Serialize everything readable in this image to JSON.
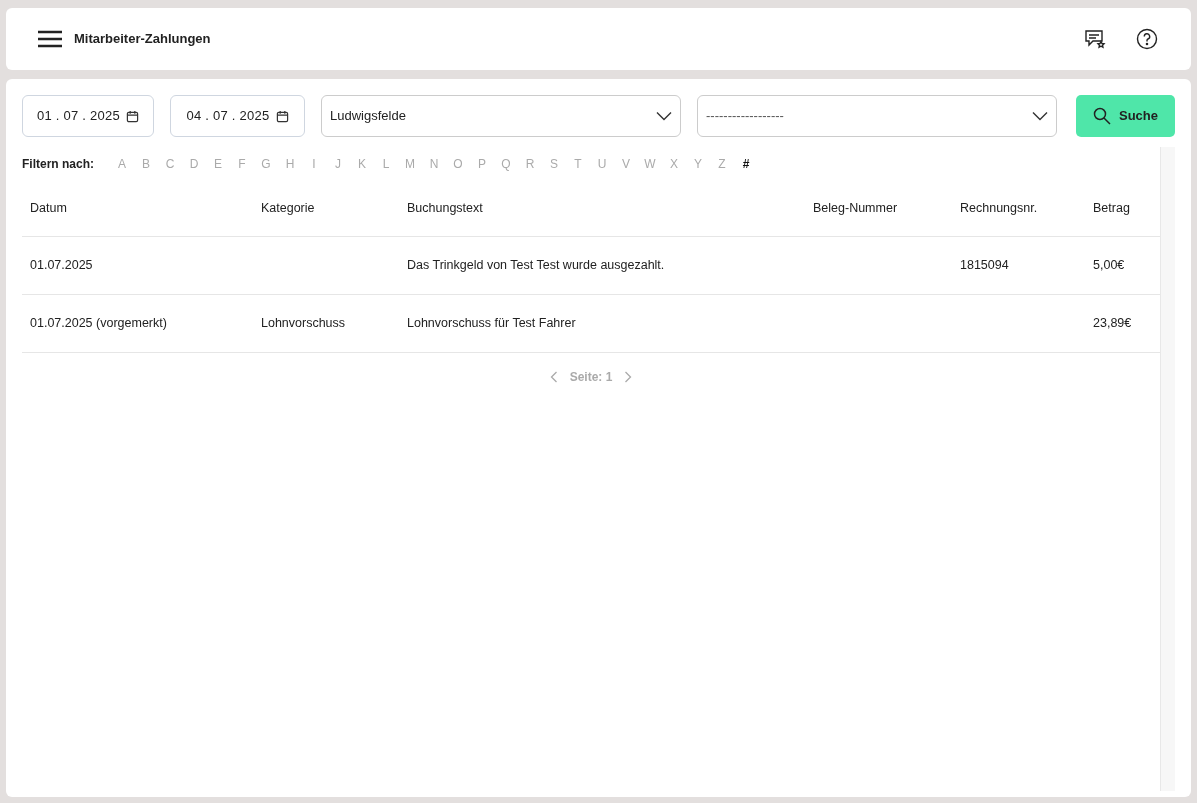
{
  "header": {
    "title": "Mitarbeiter-Zahlungen"
  },
  "filters": {
    "date_from": "01 . 07 . 2025",
    "date_to": "04 . 07 . 2025",
    "location": "Ludwigsfelde",
    "select_2": "------------------",
    "search_button": "Suche"
  },
  "letter_filter": {
    "label": "Filtern nach:",
    "letters": [
      {
        "label": "A",
        "selected": false
      },
      {
        "label": "B",
        "selected": false
      },
      {
        "label": "C",
        "selected": false
      },
      {
        "label": "D",
        "selected": false
      },
      {
        "label": "E",
        "selected": false
      },
      {
        "label": "F",
        "selected": false
      },
      {
        "label": "G",
        "selected": false
      },
      {
        "label": "H",
        "selected": false
      },
      {
        "label": "I",
        "selected": false
      },
      {
        "label": "J",
        "selected": false
      },
      {
        "label": "K",
        "selected": false
      },
      {
        "label": "L",
        "selected": false
      },
      {
        "label": "M",
        "selected": false
      },
      {
        "label": "N",
        "selected": false
      },
      {
        "label": "O",
        "selected": false
      },
      {
        "label": "P",
        "selected": false
      },
      {
        "label": "Q",
        "selected": false
      },
      {
        "label": "R",
        "selected": false
      },
      {
        "label": "S",
        "selected": false
      },
      {
        "label": "T",
        "selected": false
      },
      {
        "label": "U",
        "selected": false
      },
      {
        "label": "V",
        "selected": false
      },
      {
        "label": "W",
        "selected": false
      },
      {
        "label": "X",
        "selected": false
      },
      {
        "label": "Y",
        "selected": false
      },
      {
        "label": "Z",
        "selected": false
      },
      {
        "label": "#",
        "selected": true
      }
    ]
  },
  "table": {
    "columns": [
      "Datum",
      "Kategorie",
      "Buchungstext",
      "Beleg-Nummer",
      "Rechnungsnr.",
      "Betrag"
    ],
    "rows": [
      [
        "01.07.2025",
        "",
        "Das Trinkgeld von Test Test wurde ausgezahlt.",
        "",
        "1815094",
        "5,00€"
      ],
      [
        "01.07.2025 (vorgemerkt)",
        "Lohnvorschuss",
        "Lohnvorschuss für Test Fahrer",
        "",
        "",
        "23,89€"
      ]
    ]
  },
  "pagination": {
    "label": "Seite: 1"
  }
}
